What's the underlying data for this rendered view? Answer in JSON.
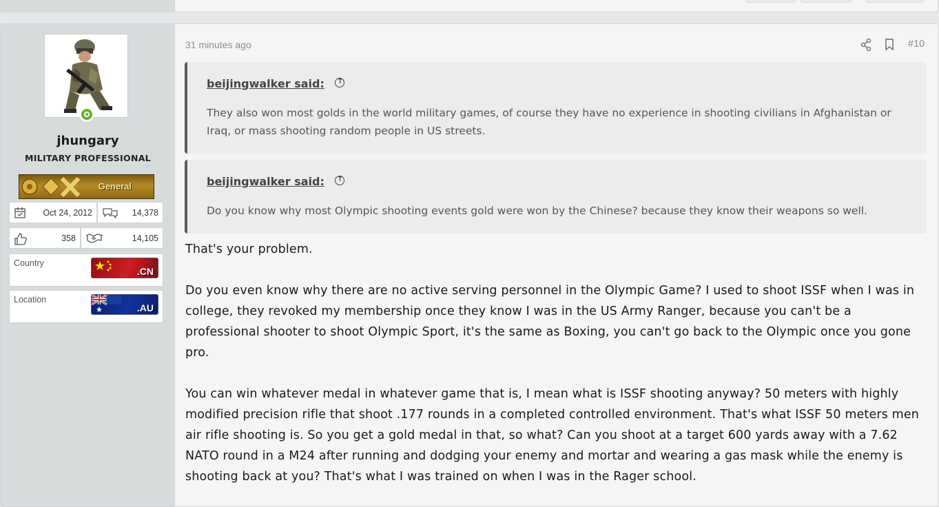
{
  "post": {
    "time": "31 minutes ago",
    "number": "#10",
    "actions": {
      "share_icon": "share-icon",
      "bookmark_icon": "bookmark-icon"
    }
  },
  "user": {
    "name": "jhungary",
    "title": "MILITARY PROFESSIONAL",
    "rank_label": "General",
    "joined": "Oct 24, 2012",
    "messages": "14,378",
    "reactions": "358",
    "points": "14,105",
    "country_label": "Country",
    "country_flag": ".CN",
    "location_label": "Location",
    "location_flag": ".AU",
    "online_status_icon": "online-icon"
  },
  "quotes": [
    {
      "author": "beijingwalker said:",
      "text": "They also won most golds in the world military games, of course they have no experience in shooting civilians in Afghanistan or Iraq, or mass shooting random people in US streets."
    },
    {
      "author": "beijingwalker said:",
      "text": "Do you know why most Olympic shooting events gold were won by the Chinese? because they know their weapons so well."
    }
  ],
  "body": {
    "p1": "That's your problem.",
    "p2": "Do you even know why there are no active serving personnel in the Olympic Game? I used to shoot ISSF when I was in college, they revoked my membership once they know I was in the US Army Ranger, because you can't be a professional shooter to shoot Olympic Sport, it's the same as Boxing, you can't go back to the Olympic once you gone pro.",
    "p3": "You can win whatever medal in whatever game that is, I mean what is ISSF shooting anyway? 50 meters with highly modified precision rifle that shoot .177 rounds in a completed controlled environment. That's what ISSF 50 meters men air rifle shooting is. So you get a gold medal in that, so what? Can you shoot at a target 600 yards away with a 7.62 NATO round in a M24 after running and dodging your enemy and mortar and wearing a gas mask while the enemy is shooting back at you? That's what I was trained on when I was in the Rager school."
  },
  "colors": {
    "sidebar_bg": "#d7dbdc",
    "post_bg": "#f5f5f5",
    "quote_bg": "#ebecec",
    "online_green": "#63b32e",
    "meta_gray": "#8a8d8f"
  }
}
